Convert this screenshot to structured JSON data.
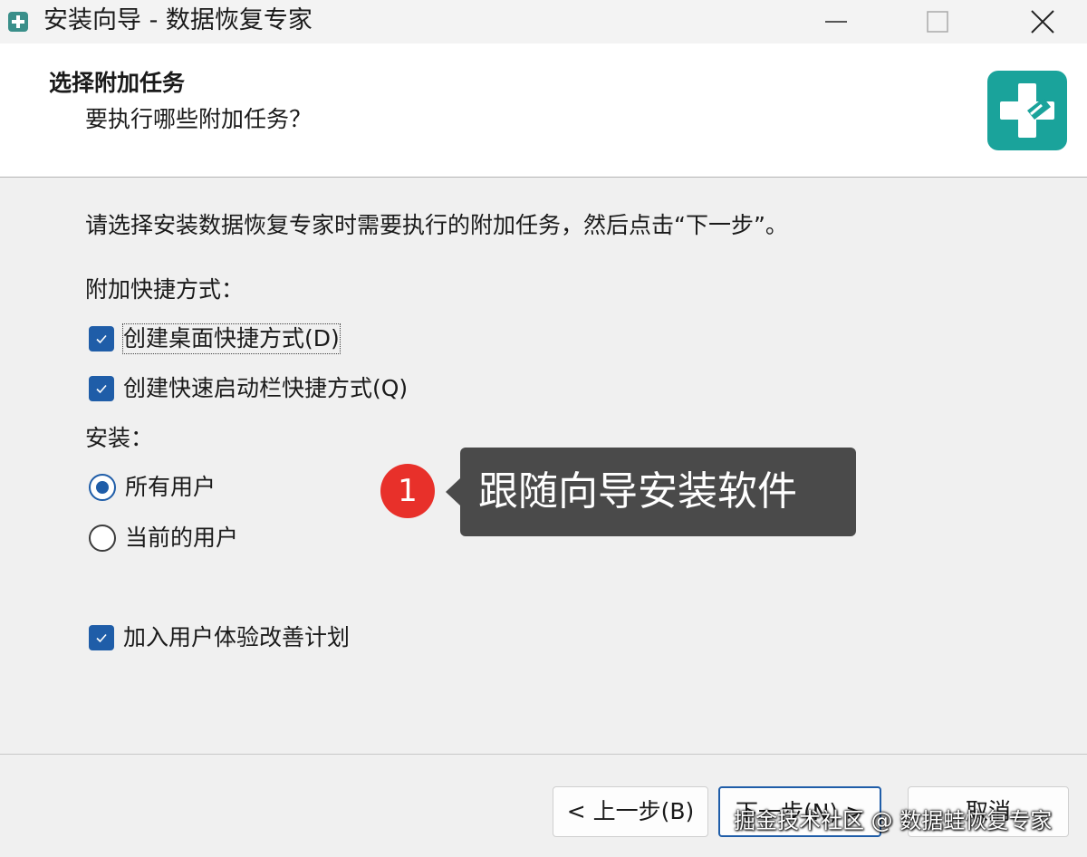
{
  "window": {
    "title": "安装向导 - 数据恢复专家"
  },
  "header": {
    "title": "选择附加任务",
    "subtitle": "要执行哪些附加任务？"
  },
  "body": {
    "instruction": "请选择安装数据恢复专家时需要执行的附加任务，然后点击“下一步”。",
    "shortcuts_label": "附加快捷方式：",
    "shortcut_options": [
      {
        "label": "创建桌面快捷方式(D)",
        "checked": true
      },
      {
        "label": "创建快速启动栏快捷方式(Q)",
        "checked": true
      }
    ],
    "install_label": "安装：",
    "install_options": [
      {
        "label": "所有用户",
        "selected": true
      },
      {
        "label": "当前的用户",
        "selected": false
      }
    ],
    "ux_program": {
      "label": "加入用户体验改善计划",
      "checked": true
    }
  },
  "annotation": {
    "badge": "1",
    "text": "跟随向导安装软件"
  },
  "footer": {
    "back_label": "< 上一步(B)",
    "next_label": "下一步(N) >",
    "cancel_label": "取消"
  },
  "watermark": "掘金技术社区 @ 数据蛙恢复专家",
  "colors": {
    "accent": "#1f5da8",
    "logo": "#1aa39b",
    "badge": "#e8302a",
    "callout": "#4a4a4a"
  }
}
